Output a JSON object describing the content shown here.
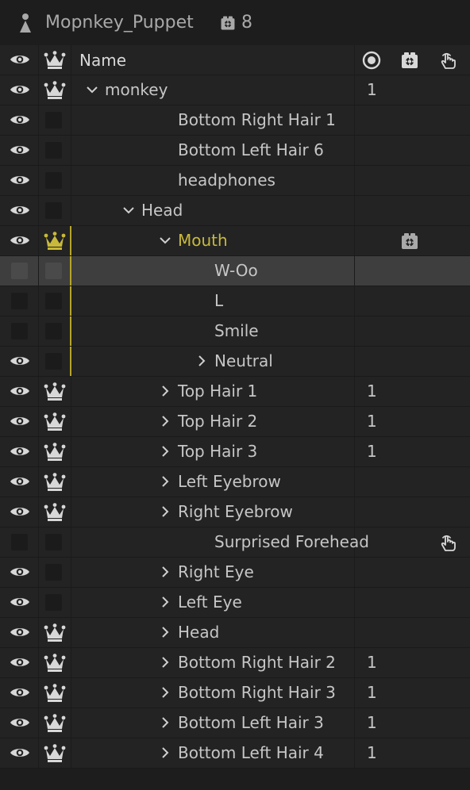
{
  "panel": {
    "title": "Mopnkey_Puppet",
    "camera_count": "8"
  },
  "header": {
    "name_label": "Name"
  },
  "colors": {
    "accent_gold": "#c8b93a",
    "selected_row": "#3e3e3e"
  },
  "rows": [
    {
      "label": "monkey",
      "visible": true,
      "crown": true,
      "expand": "down",
      "num": "1",
      "icon": ""
    },
    {
      "label": "Bottom Right Hair 1",
      "visible": true,
      "crown": false,
      "expand": "",
      "num": "",
      "icon": ""
    },
    {
      "label": "Bottom Left Hair 6",
      "visible": true,
      "crown": false,
      "expand": "",
      "num": "",
      "icon": ""
    },
    {
      "label": "headphones",
      "visible": true,
      "crown": false,
      "expand": "",
      "num": "",
      "icon": ""
    },
    {
      "label": "Head",
      "visible": true,
      "crown": false,
      "expand": "down",
      "num": "",
      "icon": ""
    },
    {
      "label": "Mouth",
      "visible": true,
      "crown": true,
      "expand": "down",
      "num": "",
      "icon": "camera-gear-icon"
    },
    {
      "label": "W-Oo",
      "visible": false,
      "crown": false,
      "expand": "",
      "num": "",
      "icon": ""
    },
    {
      "label": "L",
      "visible": false,
      "crown": false,
      "expand": "",
      "num": "",
      "icon": ""
    },
    {
      "label": "Smile",
      "visible": false,
      "crown": false,
      "expand": "",
      "num": "",
      "icon": ""
    },
    {
      "label": "Neutral",
      "visible": true,
      "crown": false,
      "expand": "right",
      "num": "",
      "icon": ""
    },
    {
      "label": "Top Hair 1",
      "visible": true,
      "crown": true,
      "expand": "right",
      "num": "1",
      "icon": ""
    },
    {
      "label": "Top Hair 2",
      "visible": true,
      "crown": true,
      "expand": "right",
      "num": "1",
      "icon": ""
    },
    {
      "label": "Top Hair 3",
      "visible": true,
      "crown": true,
      "expand": "right",
      "num": "1",
      "icon": ""
    },
    {
      "label": "Left Eyebrow",
      "visible": true,
      "crown": true,
      "expand": "right",
      "num": "",
      "icon": ""
    },
    {
      "label": "Right Eyebrow",
      "visible": true,
      "crown": true,
      "expand": "right",
      "num": "",
      "icon": ""
    },
    {
      "label": "Surprised Forehead",
      "visible": false,
      "crown": false,
      "expand": "",
      "num": "",
      "icon": "hand-touch-icon"
    },
    {
      "label": "Right Eye",
      "visible": true,
      "crown": false,
      "expand": "right",
      "num": "",
      "icon": ""
    },
    {
      "label": "Left Eye",
      "visible": true,
      "crown": false,
      "expand": "right",
      "num": "",
      "icon": ""
    },
    {
      "label": "Head",
      "visible": true,
      "crown": true,
      "expand": "right",
      "num": "",
      "icon": ""
    },
    {
      "label": "Bottom Right Hair 2",
      "visible": true,
      "crown": true,
      "expand": "right",
      "num": "1",
      "icon": ""
    },
    {
      "label": "Bottom Right Hair 3",
      "visible": true,
      "crown": true,
      "expand": "right",
      "num": "1",
      "icon": ""
    },
    {
      "label": "Bottom Left Hair 3",
      "visible": true,
      "crown": true,
      "expand": "right",
      "num": "1",
      "icon": ""
    },
    {
      "label": "Bottom Left Hair 4",
      "visible": true,
      "crown": true,
      "expand": "right",
      "num": "1",
      "icon": ""
    }
  ]
}
